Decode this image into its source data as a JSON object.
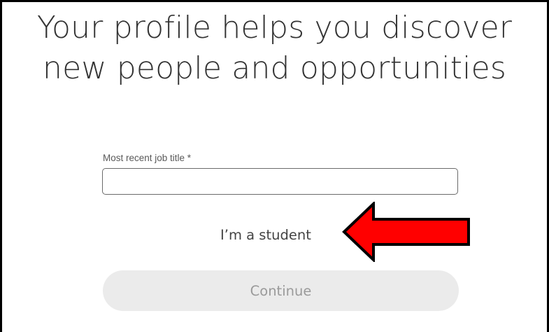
{
  "header": {
    "title": "Your profile helps you discover new people and opportunities"
  },
  "form": {
    "job_title_label": "Most recent job title *",
    "job_title_value": "",
    "student_link": "I’m a student",
    "continue_label": "Continue"
  },
  "annotation": {
    "arrow_color": "#ff0000",
    "arrow_outline": "#000000",
    "arrow_direction": "left",
    "points_to": "student_link"
  }
}
